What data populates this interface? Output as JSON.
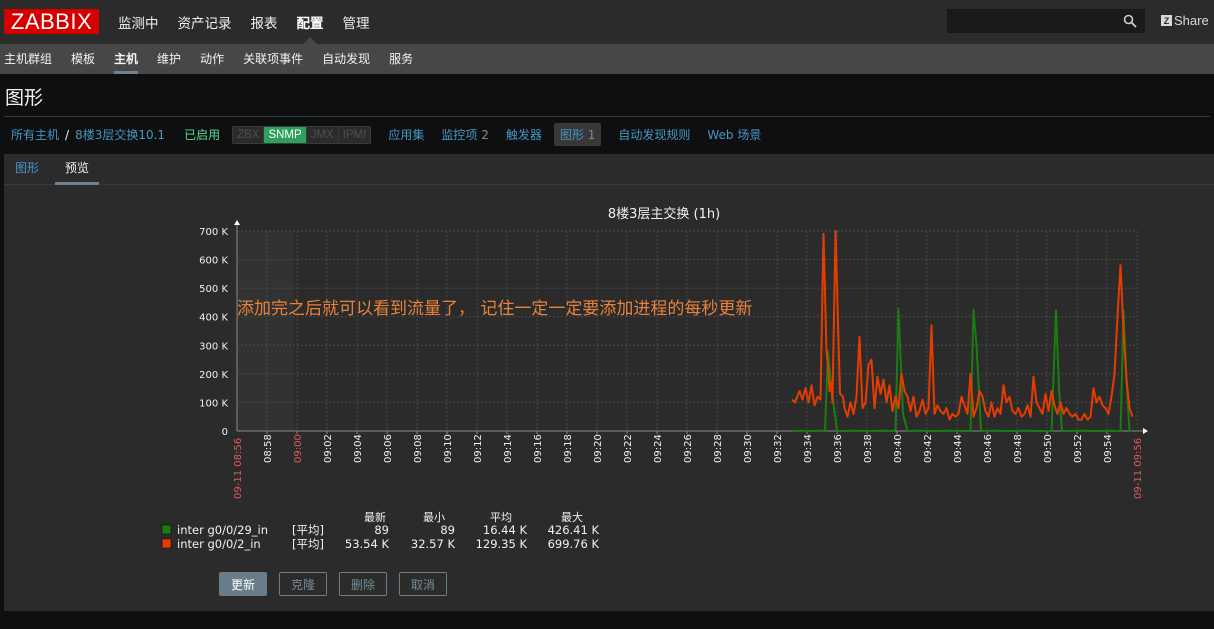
{
  "header": {
    "logo": "ZABBIX",
    "menu": [
      "监测中",
      "资产记录",
      "报表",
      "配置",
      "管理"
    ],
    "active_menu_index": 3,
    "search": {
      "value": "",
      "placeholder": ""
    },
    "share_label": "Share",
    "share_icon_letter": "Z"
  },
  "subnav": {
    "items": [
      "主机群组",
      "模板",
      "主机",
      "维护",
      "动作",
      "关联项事件",
      "自动发现",
      "服务"
    ],
    "active_index": 2
  },
  "page": {
    "title": "图形"
  },
  "hostbar": {
    "breadcrumb_root": "所有主机",
    "breadcrumb_sep": "/",
    "host_name": "8楼3层交换10.1",
    "status": "已启用",
    "availability": [
      {
        "label": "ZBX",
        "active": false
      },
      {
        "label": "SNMP",
        "active": true
      },
      {
        "label": "JMX",
        "active": false
      },
      {
        "label": "IPMI",
        "active": false
      }
    ],
    "links": [
      {
        "label": "应用集",
        "count": ""
      },
      {
        "label": "监控项",
        "count": "2"
      },
      {
        "label": "触发器",
        "count": ""
      },
      {
        "label": "图形",
        "count": "1",
        "selected": true
      },
      {
        "label": "自动发现规则",
        "count": ""
      },
      {
        "label": "Web 场景",
        "count": ""
      }
    ]
  },
  "tabs": [
    {
      "label": "图形",
      "active": false
    },
    {
      "label": "预览",
      "active": true
    }
  ],
  "annotation": "添加完之后就可以看到流量了，   记住一定一定要添加进程的每秒更新",
  "chart_data": {
    "type": "line",
    "title": "8楼3层主交换 (1h)",
    "xlabel": "",
    "ylabel": "",
    "ylim": [
      0,
      700000
    ],
    "y_ticks": [
      "0",
      "100 K",
      "200 K",
      "300 K",
      "400 K",
      "500 K",
      "600 K",
      "700 K"
    ],
    "x_range_minutes": [
      0,
      60
    ],
    "x_start_label": "09-11 08:56",
    "x_end_label": "09-11 09:56",
    "x_ticks": [
      {
        "m": 2,
        "label": "08:58"
      },
      {
        "m": 4,
        "label": "09:00",
        "highlight": true
      },
      {
        "m": 6,
        "label": "09:02"
      },
      {
        "m": 8,
        "label": "09:04"
      },
      {
        "m": 10,
        "label": "09:06"
      },
      {
        "m": 12,
        "label": "09:08"
      },
      {
        "m": 14,
        "label": "09:10"
      },
      {
        "m": 16,
        "label": "09:12"
      },
      {
        "m": 18,
        "label": "09:14"
      },
      {
        "m": 20,
        "label": "09:16"
      },
      {
        "m": 22,
        "label": "09:18"
      },
      {
        "m": 24,
        "label": "09:20"
      },
      {
        "m": 26,
        "label": "09:22"
      },
      {
        "m": 28,
        "label": "09:24"
      },
      {
        "m": 30,
        "label": "09:26"
      },
      {
        "m": 32,
        "label": "09:28"
      },
      {
        "m": 34,
        "label": "09:30"
      },
      {
        "m": 36,
        "label": "09:32"
      },
      {
        "m": 38,
        "label": "09:34"
      },
      {
        "m": 40,
        "label": "09:36"
      },
      {
        "m": 42,
        "label": "09:38"
      },
      {
        "m": 44,
        "label": "09:40"
      },
      {
        "m": 46,
        "label": "09:42"
      },
      {
        "m": 48,
        "label": "09:44"
      },
      {
        "m": 50,
        "label": "09:46"
      },
      {
        "m": 52,
        "label": "09:48"
      },
      {
        "m": 54,
        "label": "09:50"
      },
      {
        "m": 56,
        "label": "09:52"
      },
      {
        "m": 58,
        "label": "09:54"
      }
    ],
    "no_data_shade_minutes": [
      0,
      3.8
    ],
    "grid": true,
    "legend_position": "bottom-left",
    "stat_headers": [
      "最新",
      "最小",
      "平均",
      "最大"
    ],
    "series": [
      {
        "name": "inter g0/0/29_in",
        "color": "#1a7c11",
        "func": "[平均]",
        "last": "89",
        "min": "89",
        "avg": "16.44 K",
        "max": "426.41 K",
        "x": [
          37.0,
          37.6,
          38.2,
          38.8,
          39.2,
          39.4,
          39.7,
          40.0,
          40.3,
          41.2,
          42.0,
          43.0,
          43.7,
          43.9,
          44.1,
          44.4,
          44.7,
          45.5,
          46.5,
          47.5,
          48.3,
          48.9,
          49.1,
          49.3,
          49.6,
          50.5,
          51.5,
          52.5,
          53.5,
          54.3,
          54.6,
          54.8,
          55.0,
          55.3,
          56.3,
          57.3,
          58.3,
          58.9,
          59.1,
          59.3,
          59.5,
          59.7
        ],
        "y": [
          0,
          1000,
          0,
          1000,
          0,
          280000,
          120000,
          0,
          0,
          1000,
          0,
          1000,
          0,
          5000,
          426000,
          60000,
          0,
          1000,
          0,
          1000,
          0,
          0,
          425000,
          300000,
          0,
          1000,
          0,
          1000,
          0,
          0,
          422000,
          150000,
          0,
          0,
          1000,
          0,
          1000,
          0,
          420000,
          180000,
          0,
          0
        ]
      },
      {
        "name": "inter g0/0/2_in",
        "color": "#e53d00",
        "func": "[平均]",
        "last": "53.54 K",
        "min": "32.57 K",
        "avg": "129.35 K",
        "max": "699.76 K",
        "x": [
          37.0,
          37.2,
          37.5,
          37.7,
          37.9,
          38.1,
          38.3,
          38.5,
          38.7,
          38.9,
          39.1,
          39.3,
          39.4,
          39.5,
          39.6,
          39.7,
          39.9,
          40.2,
          40.4,
          40.5,
          40.7,
          40.9,
          41.1,
          41.3,
          41.5,
          41.7,
          41.9,
          42.1,
          42.3,
          42.5,
          42.7,
          42.9,
          43.1,
          43.3,
          43.5,
          43.7,
          43.9,
          44.1,
          44.3,
          44.5,
          44.7,
          44.9,
          45.1,
          45.3,
          45.5,
          45.7,
          45.9,
          46.1,
          46.3,
          46.5,
          46.7,
          46.9,
          47.1,
          47.3,
          47.5,
          47.7,
          47.9,
          48.1,
          48.3,
          48.5,
          48.7,
          48.9,
          49.1,
          49.3,
          49.5,
          49.7,
          49.9,
          50.1,
          50.3,
          50.5,
          50.7,
          50.9,
          51.1,
          51.3,
          51.5,
          51.7,
          51.9,
          52.1,
          52.3,
          52.5,
          52.7,
          52.9,
          53.1,
          53.3,
          53.5,
          53.7,
          53.9,
          54.1,
          54.3,
          54.5,
          54.7,
          54.9,
          55.1,
          55.3,
          55.5,
          55.7,
          55.9,
          56.1,
          56.3,
          56.5,
          56.7,
          56.9,
          57.1,
          57.3,
          57.5,
          57.7,
          57.9,
          58.1,
          58.3,
          58.5,
          58.7,
          58.9,
          59.1,
          59.3,
          59.5,
          59.7,
          59.9
        ],
        "y": [
          110000,
          100000,
          140000,
          110000,
          150000,
          100000,
          160000,
          90000,
          120000,
          110000,
          690000,
          280000,
          230000,
          140000,
          170000,
          100000,
          700000,
          130000,
          120000,
          80000,
          50000,
          100000,
          60000,
          120000,
          330000,
          80000,
          100000,
          230000,
          250000,
          80000,
          190000,
          130000,
          180000,
          100000,
          160000,
          70000,
          120000,
          80000,
          200000,
          140000,
          120000,
          70000,
          120000,
          50000,
          70000,
          110000,
          60000,
          80000,
          370000,
          60000,
          90000,
          70000,
          60000,
          80000,
          40000,
          60000,
          50000,
          60000,
          120000,
          90000,
          60000,
          200000,
          50000,
          80000,
          140000,
          120000,
          70000,
          50000,
          100000,
          50000,
          80000,
          60000,
          160000,
          100000,
          120000,
          70000,
          60000,
          80000,
          50000,
          60000,
          90000,
          50000,
          190000,
          100000,
          80000,
          60000,
          130000,
          70000,
          140000,
          90000,
          60000,
          100000,
          60000,
          80000,
          60000,
          50000,
          60000,
          40000,
          40000,
          60000,
          40000,
          50000,
          150000,
          100000,
          120000,
          90000,
          80000,
          60000,
          120000,
          200000,
          400000,
          580000,
          350000,
          180000,
          80000,
          50000
        ]
      }
    ]
  },
  "buttons": [
    "更新",
    "克隆",
    "删除",
    "取消"
  ]
}
